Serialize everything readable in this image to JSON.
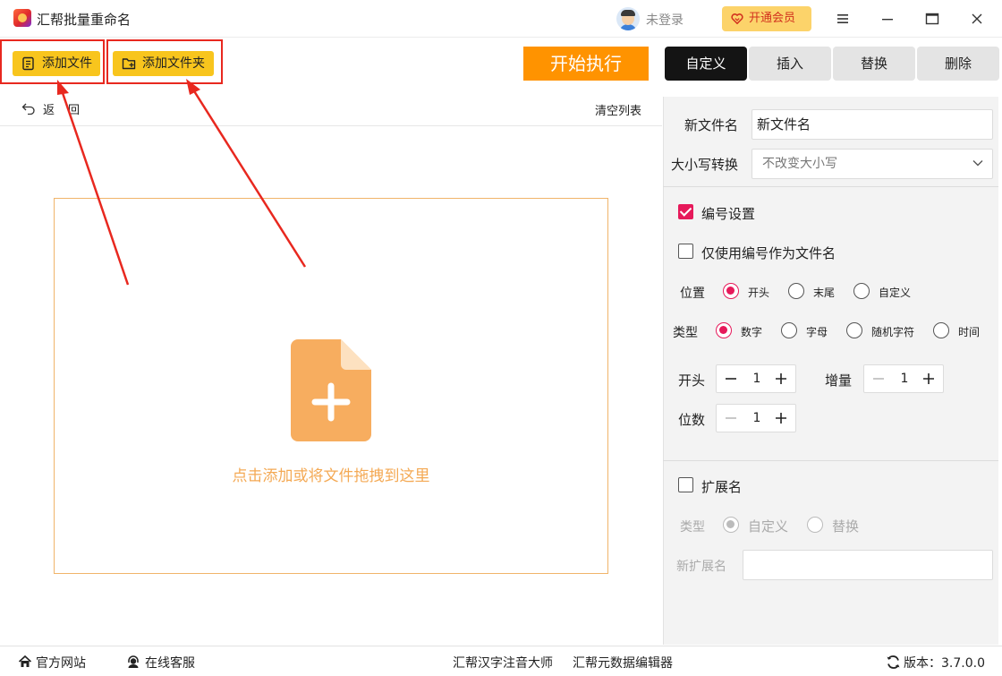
{
  "app": {
    "title": "汇帮批量重命名"
  },
  "header": {
    "login_label": "未登录",
    "vip_label": "开通会员",
    "icons": [
      "avatar",
      "heart-icon",
      "menu-icon",
      "minimize-icon",
      "maximize-icon",
      "close-icon"
    ]
  },
  "toolbar": {
    "add_file_label": "添加文件",
    "add_folder_label": "添加文件夹",
    "start_label": "开始执行"
  },
  "tabs": [
    {
      "label": "自定义",
      "active": true
    },
    {
      "label": "插入",
      "active": false
    },
    {
      "label": "替换",
      "active": false
    },
    {
      "label": "删除",
      "active": false
    }
  ],
  "list": {
    "back_label_1": "返",
    "back_label_2": "回",
    "clear_label": "清空列表",
    "drop_text": "点击添加或将文件拖拽到这里"
  },
  "rename": {
    "new_name_label": "新文件名",
    "new_name_value": "新文件名",
    "case_label": "大小写转换",
    "case_value": "不改变大小写"
  },
  "numbering": {
    "enable_label": "编号设置",
    "enabled": true,
    "only_number_label": "仅使用编号作为文件名",
    "only_number": false,
    "position_label": "位置",
    "position_options": [
      "开头",
      "末尾",
      "自定义"
    ],
    "position_selected": "开头",
    "type_label": "类型",
    "type_options": [
      "数字",
      "字母",
      "随机字符",
      "时间"
    ],
    "type_selected": "数字",
    "start_label": "开头",
    "start_value": "1",
    "step_label": "增量",
    "step_value": "1",
    "digits_label": "位数",
    "digits_value": "1"
  },
  "extension": {
    "enable_label": "扩展名",
    "enabled": false,
    "type_label": "类型",
    "type_options": [
      "自定义",
      "替换"
    ],
    "type_selected": "自定义",
    "new_ext_label": "新扩展名",
    "new_ext_value": ""
  },
  "footer": {
    "website_label": "官方网站",
    "service_label": "在线客服",
    "link1_label": "汇帮汉字注音大师",
    "link2_label": "汇帮元数据编辑器",
    "version_label": "版本：3.7.0.0"
  },
  "colors": {
    "accent_yellow": "#f8c51d",
    "start_orange": "#ff9300",
    "checked_pink": "#e6195a",
    "annotation_red": "#e8281f",
    "drop_orange": "#f4a954"
  }
}
